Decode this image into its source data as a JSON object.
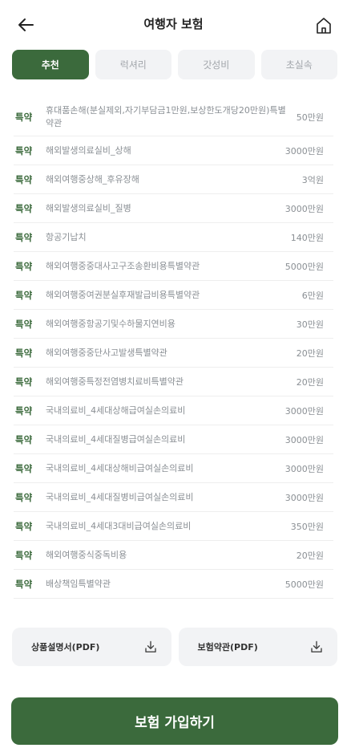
{
  "header": {
    "title": "여행자 보험",
    "back_icon": "arrow-left-icon",
    "home_icon": "home-icon"
  },
  "tabs": [
    {
      "label": "추천",
      "active": true
    },
    {
      "label": "럭셔리",
      "active": false
    },
    {
      "label": "갓성비",
      "active": false
    },
    {
      "label": "초실속",
      "active": false
    }
  ],
  "coverage": [
    {
      "tag": "특약",
      "name": "휴대품손해(분실제외,자기부담금1만원,보상한도개당20만원)특별약관",
      "amount": "50만원"
    },
    {
      "tag": "특약",
      "name": "해외발생의료실비_상해",
      "amount": "3000만원"
    },
    {
      "tag": "특약",
      "name": "해외여행중상해_후유장해",
      "amount": "3억원"
    },
    {
      "tag": "특약",
      "name": "해외발생의료실비_질병",
      "amount": "3000만원"
    },
    {
      "tag": "특약",
      "name": "항공기납치",
      "amount": "140만원"
    },
    {
      "tag": "특약",
      "name": "해외여행중중대사고구조송환비용특별약관",
      "amount": "5000만원"
    },
    {
      "tag": "특약",
      "name": "해외여행중여권분실후재발급비용특별약관",
      "amount": "6만원"
    },
    {
      "tag": "특약",
      "name": "해외여행중항공기및수하물지연비용",
      "amount": "30만원"
    },
    {
      "tag": "특약",
      "name": "해외여행중중단사고발생특별약관",
      "amount": "20만원"
    },
    {
      "tag": "특약",
      "name": "해외여행중특정전염병치료비특별약관",
      "amount": "20만원"
    },
    {
      "tag": "특약",
      "name": "국내의료비_4세대상해급여실손의료비",
      "amount": "3000만원"
    },
    {
      "tag": "특약",
      "name": "국내의료비_4세대질병급여실손의료비",
      "amount": "3000만원"
    },
    {
      "tag": "특약",
      "name": "국내의료비_4세대상해비급여실손의료비",
      "amount": "3000만원"
    },
    {
      "tag": "특약",
      "name": "국내의료비_4세대질병비급여실손의료비",
      "amount": "3000만원"
    },
    {
      "tag": "특약",
      "name": "국내의료비_4세대3대비급여실손의료비",
      "amount": "350만원"
    },
    {
      "tag": "특약",
      "name": "해외여행중식중독비용",
      "amount": "20만원"
    },
    {
      "tag": "특약",
      "name": "배상책임특별약관",
      "amount": "5000만원"
    }
  ],
  "documents": {
    "product_manual": {
      "label": "상품설명서(PDF)",
      "icon": "download-icon"
    },
    "policy_terms": {
      "label": "보험약관(PDF)",
      "icon": "download-icon"
    }
  },
  "cta": {
    "label": "보험 가입하기"
  },
  "colors": {
    "primary": "#3b6a3c",
    "tab_inactive_bg": "#f2f3f5",
    "tab_inactive_text": "#a2a6ab",
    "muted_text": "#8a8f94"
  }
}
